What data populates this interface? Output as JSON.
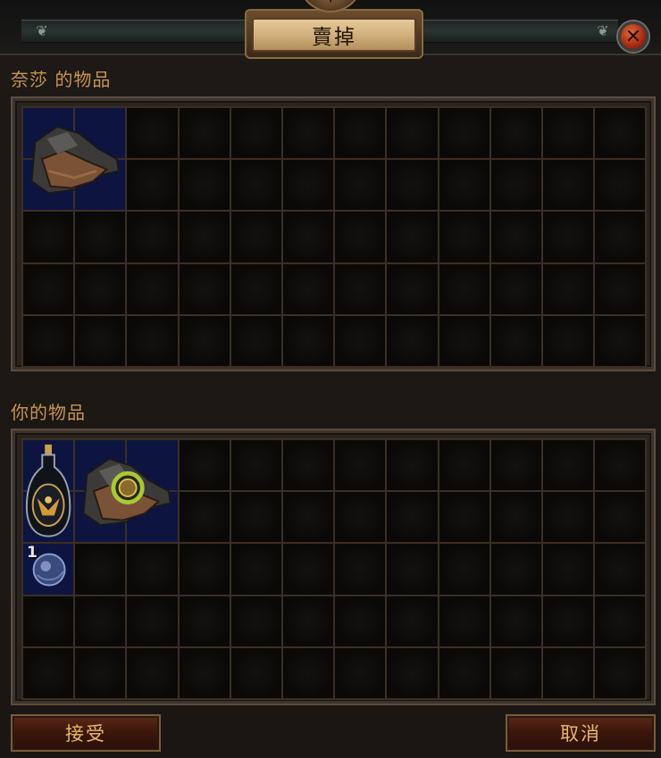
{
  "window": {
    "title": "賣掉",
    "medallion_symbol": "$",
    "close_symbol": "✕"
  },
  "sections": {
    "their_items_label": "奈莎 的物品",
    "your_items_label": "你的物品"
  },
  "grid": {
    "columns": 12,
    "rows": 5
  },
  "their_items": [
    {
      "name": "boots-icon",
      "col": 1,
      "row": 1,
      "w": 2,
      "h": 2
    }
  ],
  "your_items": [
    {
      "name": "flask-icon",
      "col": 1,
      "row": 1,
      "w": 1,
      "h": 2
    },
    {
      "name": "boots-with-ring-icon",
      "col": 2,
      "row": 1,
      "w": 2,
      "h": 2
    },
    {
      "name": "orb-icon",
      "col": 1,
      "row": 3,
      "w": 1,
      "h": 1,
      "stack": "1"
    }
  ],
  "buttons": {
    "accept_label": "接受",
    "cancel_label": "取消"
  },
  "colors": {
    "label_orange": "#c9934f",
    "occupied_cell": "#0d1440",
    "button_text": "#e9b86a"
  }
}
